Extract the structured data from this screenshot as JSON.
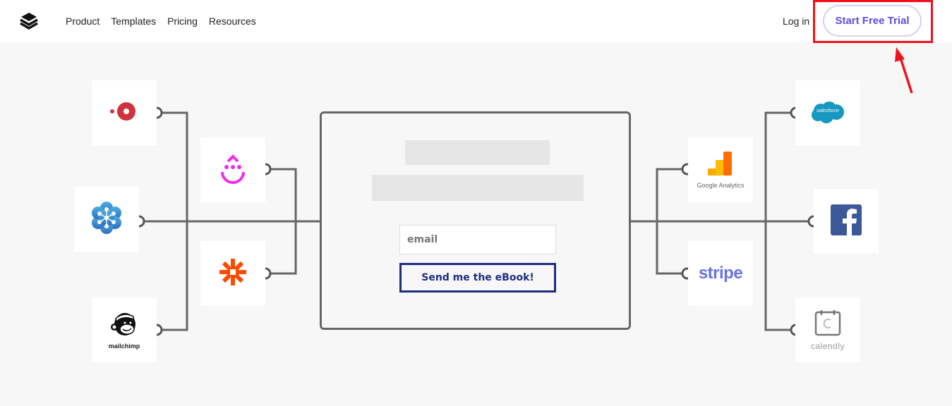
{
  "nav": {
    "logo_icon": "layers-stack-icon",
    "links": [
      {
        "label": "Product"
      },
      {
        "label": "Templates"
      },
      {
        "label": "Pricing"
      },
      {
        "label": "Resources"
      }
    ],
    "login_label": "Log in",
    "cta_label": "Start Free Trial"
  },
  "annotation": {
    "highlight_color": "#f0121b",
    "target": "Start Free Trial"
  },
  "diagram": {
    "left_integrations": [
      {
        "name": "Podia",
        "icon": "podia-dot-icon"
      },
      {
        "name": "GoToWebinar",
        "icon": "gotowebinar-flower-icon"
      },
      {
        "name": "mailchimp",
        "icon": "mailchimp-monkey-icon",
        "label": "mailchimp"
      },
      {
        "name": "Drip",
        "icon": "drip-smile-icon"
      },
      {
        "name": "Zapier",
        "icon": "zapier-asterisk-icon"
      }
    ],
    "right_integrations": [
      {
        "name": "Google Analytics",
        "icon": "google-analytics-bars-icon",
        "label": "Google Analytics"
      },
      {
        "name": "stripe",
        "icon": "stripe-wordmark-icon",
        "label": "stripe"
      },
      {
        "name": "salesforce",
        "icon": "salesforce-cloud-icon",
        "label": "salesforce"
      },
      {
        "name": "Facebook",
        "icon": "facebook-f-icon"
      },
      {
        "name": "calendly",
        "icon": "calendly-calendar-icon",
        "label": "calendly"
      }
    ],
    "form": {
      "email_placeholder": "email",
      "submit_label": "Send me the eBook!"
    }
  },
  "colors": {
    "cta_text": "#5a4fe0",
    "cta_border": "#d6d0f7",
    "button_navy": "#1d2d7e",
    "connector_gray": "#666666"
  }
}
